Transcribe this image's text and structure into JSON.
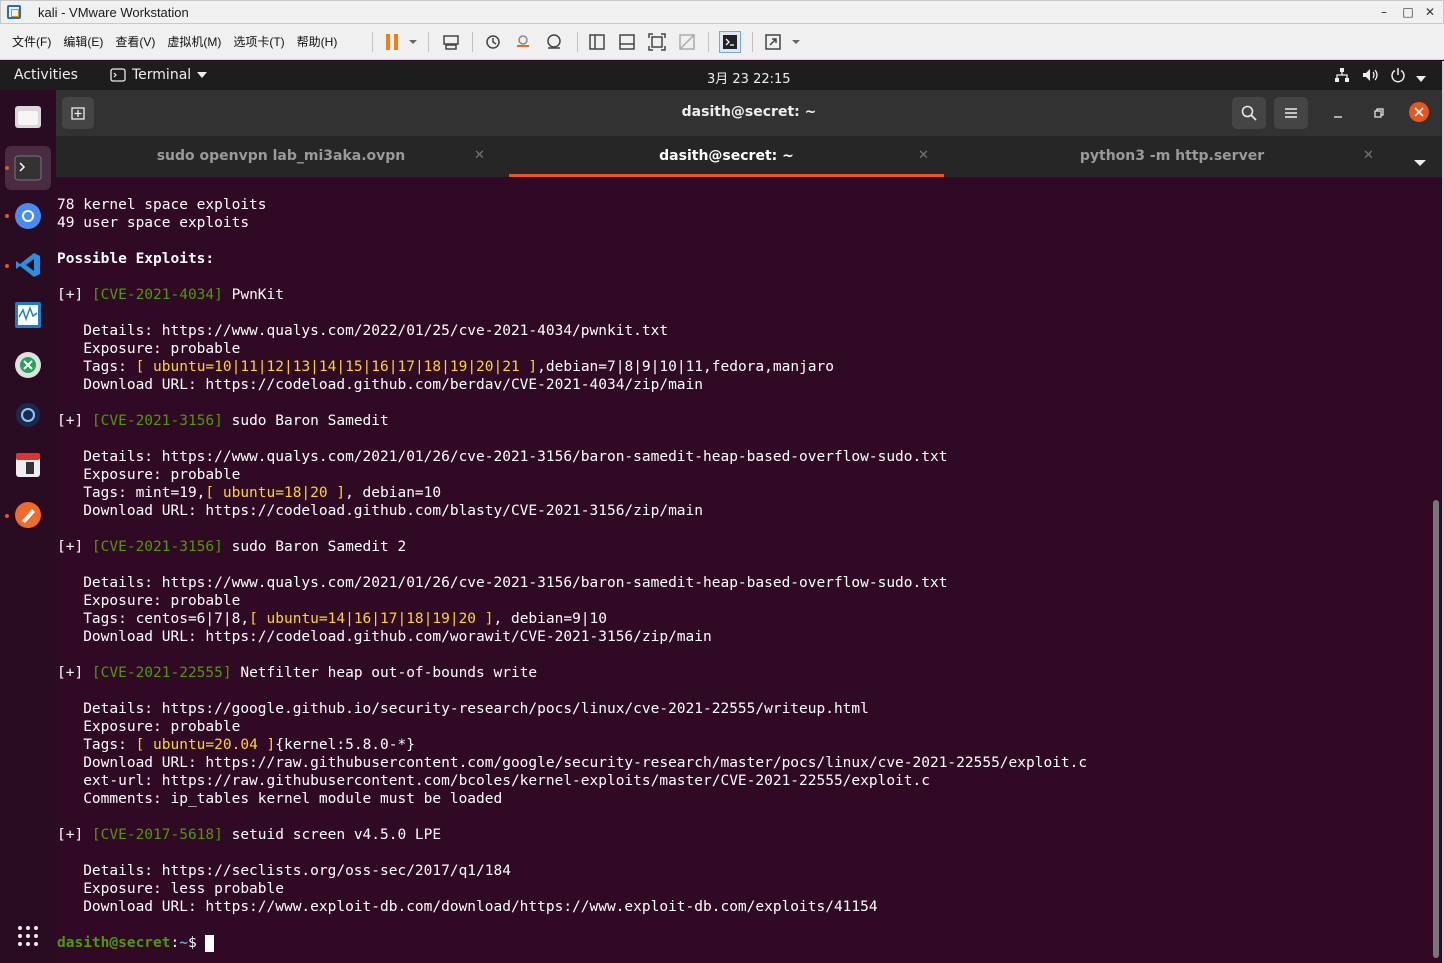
{
  "vm": {
    "title": "kali - VMware Workstation",
    "minimize": "–",
    "maximize": "□",
    "close": "✕",
    "menu": [
      "文件(F)",
      "编辑(E)",
      "查看(V)",
      "虚拟机(M)",
      "选项卡(T)",
      "帮助(H)"
    ]
  },
  "gnome": {
    "activities": "Activities",
    "app": "Terminal",
    "clock": "3月 23  22:15"
  },
  "window": {
    "title": "dasith@secret: ~"
  },
  "tabs": [
    {
      "label": "sudo openvpn lab_mi3aka.ovpn",
      "active": false
    },
    {
      "label": "dasith@secret: ~",
      "active": true
    },
    {
      "label": "python3 -m http.server",
      "active": false
    }
  ],
  "terminal": {
    "lines": [
      [
        {
          "t": "78 kernel space exploits"
        }
      ],
      [
        {
          "t": "49 user space exploits"
        }
      ],
      [],
      [
        {
          "t": "Possible Exploits:",
          "c": "b"
        }
      ],
      [],
      [
        {
          "t": "[+] "
        },
        {
          "t": "[CVE-2021-4034]",
          "c": "cve"
        },
        {
          "t": " PwnKit"
        }
      ],
      [],
      [
        {
          "t": "   Details: https://www.qualys.com/2022/01/25/cve-2021-4034/pwnkit.txt"
        }
      ],
      [
        {
          "t": "   Exposure: probable"
        }
      ],
      [
        {
          "t": "   Tags: "
        },
        {
          "t": "[ ",
          "c": "hl"
        },
        {
          "t": "ubuntu=10|11|12|13|14|15|16|17|18|19|20|21",
          "c": "hl"
        },
        {
          "t": " ]",
          "c": "hl"
        },
        {
          "t": ",debian=7|8|9|10|11,fedora,manjaro"
        }
      ],
      [
        {
          "t": "   Download URL: https://codeload.github.com/berdav/CVE-2021-4034/zip/main"
        }
      ],
      [],
      [
        {
          "t": "[+] "
        },
        {
          "t": "[CVE-2021-3156]",
          "c": "cve"
        },
        {
          "t": " sudo Baron Samedit"
        }
      ],
      [],
      [
        {
          "t": "   Details: https://www.qualys.com/2021/01/26/cve-2021-3156/baron-samedit-heap-based-overflow-sudo.txt"
        }
      ],
      [
        {
          "t": "   Exposure: probable"
        }
      ],
      [
        {
          "t": "   Tags: mint=19,"
        },
        {
          "t": "[ ubuntu=18|20 ]",
          "c": "hl"
        },
        {
          "t": ", debian=10"
        }
      ],
      [
        {
          "t": "   Download URL: https://codeload.github.com/blasty/CVE-2021-3156/zip/main"
        }
      ],
      [],
      [
        {
          "t": "[+] "
        },
        {
          "t": "[CVE-2021-3156]",
          "c": "cve"
        },
        {
          "t": " sudo Baron Samedit 2"
        }
      ],
      [],
      [
        {
          "t": "   Details: https://www.qualys.com/2021/01/26/cve-2021-3156/baron-samedit-heap-based-overflow-sudo.txt"
        }
      ],
      [
        {
          "t": "   Exposure: probable"
        }
      ],
      [
        {
          "t": "   Tags: centos=6|7|8,"
        },
        {
          "t": "[ ubuntu=14|16|17|18|19|20 ]",
          "c": "hl"
        },
        {
          "t": ", debian=9|10"
        }
      ],
      [
        {
          "t": "   Download URL: https://codeload.github.com/worawit/CVE-2021-3156/zip/main"
        }
      ],
      [],
      [
        {
          "t": "[+] "
        },
        {
          "t": "[CVE-2021-22555]",
          "c": "cve"
        },
        {
          "t": " Netfilter heap out-of-bounds write"
        }
      ],
      [],
      [
        {
          "t": "   Details: https://google.github.io/security-research/pocs/linux/cve-2021-22555/writeup.html"
        }
      ],
      [
        {
          "t": "   Exposure: probable"
        }
      ],
      [
        {
          "t": "   Tags: "
        },
        {
          "t": "[ ubuntu=20.04 ]",
          "c": "hl"
        },
        {
          "t": "{kernel:5.8.0-*}"
        }
      ],
      [
        {
          "t": "   Download URL: https://raw.githubusercontent.com/google/security-research/master/pocs/linux/cve-2021-22555/exploit.c"
        }
      ],
      [
        {
          "t": "   ext-url: https://raw.githubusercontent.com/bcoles/kernel-exploits/master/CVE-2021-22555/exploit.c"
        }
      ],
      [
        {
          "t": "   Comments: ip_tables kernel module must be loaded"
        }
      ],
      [],
      [
        {
          "t": "[+] "
        },
        {
          "t": "[CVE-2017-5618]",
          "c": "cve"
        },
        {
          "t": " setuid screen v4.5.0 LPE"
        }
      ],
      [],
      [
        {
          "t": "   Details: https://seclists.org/oss-sec/2017/q1/184"
        }
      ],
      [
        {
          "t": "   Exposure: less probable"
        }
      ],
      [
        {
          "t": "   Download URL: https://www.exploit-db.com/download/https://www.exploit-db.com/exploits/41154"
        }
      ],
      []
    ],
    "prompt_user": "dasith@secret",
    "prompt_sep": ":",
    "prompt_path": "~",
    "prompt_symbol": "$ "
  }
}
